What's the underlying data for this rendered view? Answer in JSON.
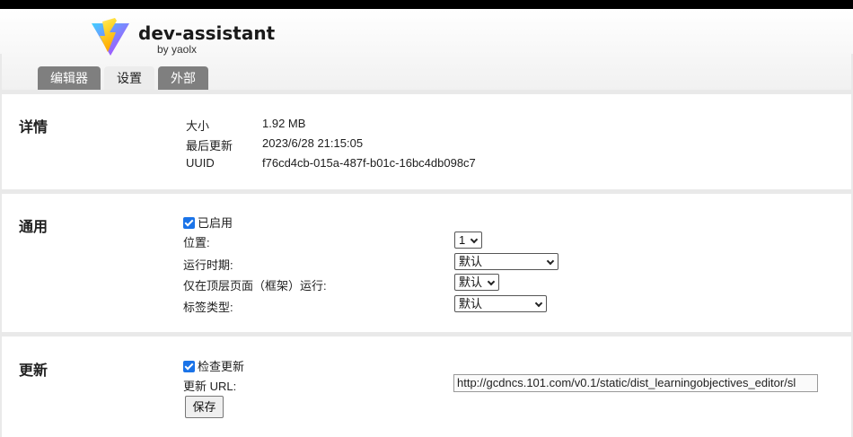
{
  "app": {
    "title": "dev-assistant",
    "author": "by yaolx",
    "logo_icon": "vite-lightning-logo"
  },
  "tabs": [
    {
      "label": "编辑器",
      "active": false
    },
    {
      "label": "设置",
      "active": true
    },
    {
      "label": "外部",
      "active": false
    }
  ],
  "details": {
    "title": "详情",
    "size_label": "大小",
    "size_value": "1.92 MB",
    "updated_label": "最后更新",
    "updated_value": "2023/6/28 21:15:05",
    "uuid_label": "UUID",
    "uuid_value": "f76cd4cb-015a-487f-b01c-16bc4db098c7"
  },
  "general": {
    "title": "通用",
    "enabled_label": "已启用",
    "enabled": true,
    "position_label": "位置:",
    "position_value": "1",
    "runat_label": "运行时期:",
    "runat_value": "默认",
    "topframe_label": "仅在顶层页面（框架）运行:",
    "topframe_value": "默认",
    "tagtype_label": "标签类型:",
    "tagtype_value": "默认"
  },
  "update": {
    "title": "更新",
    "check_label": "检查更新",
    "check_enabled": true,
    "url_label": "更新 URL:",
    "url_value": "http://gcdncs.101.com/v0.1/static/dist_learningobjectives_editor/sl",
    "save_label": "保存"
  },
  "colors": {
    "accent": "#1a73e8",
    "tab_inactive": "#7f7f7f",
    "tab_active": "#ececec"
  }
}
